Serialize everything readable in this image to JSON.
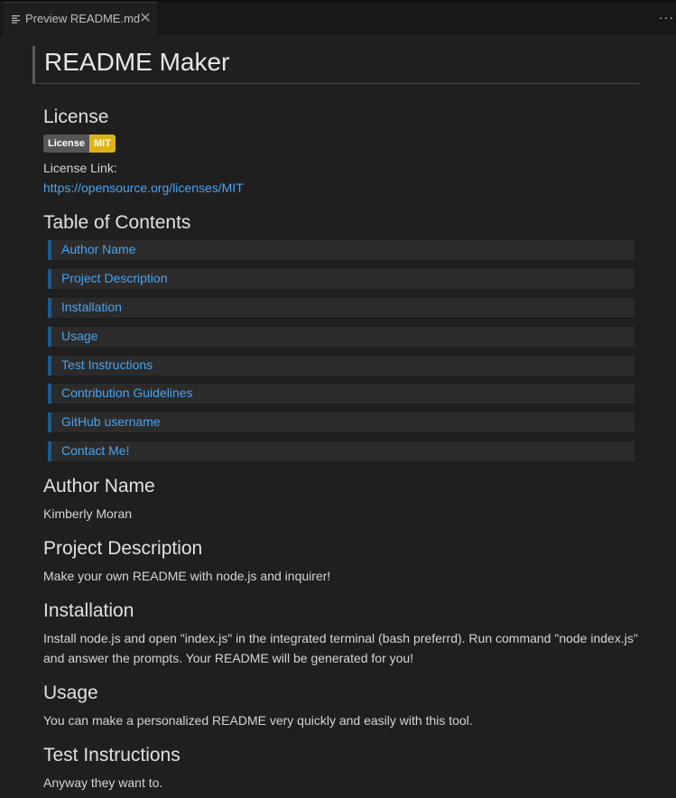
{
  "tab": {
    "title": "Preview README.md",
    "close_glyph": "✕",
    "icon": "preview-lines-icon"
  },
  "toolbar": {
    "more_glyph": "···"
  },
  "doc": {
    "title": "README Maker",
    "license": {
      "heading": "License",
      "badge_label": "License",
      "badge_value": "MIT",
      "badge_color": "#dfb317",
      "link_label": "License Link:",
      "link_url": "https://opensource.org/licenses/MIT"
    },
    "toc": {
      "heading": "Table of Contents",
      "items": [
        "Author Name",
        "Project Description",
        "Installation",
        "Usage",
        "Test Instructions",
        "Contribution Guidelines",
        "GitHub username",
        "Contact Me!"
      ]
    },
    "author": {
      "heading": "Author Name",
      "text": "Kimberly Moran"
    },
    "description": {
      "heading": "Project Description",
      "text": "Make your own README with node.js and inquirer!"
    },
    "installation": {
      "heading": "Installation",
      "line1": "Install node.js and open \"index.js\" in the integrated terminal (bash preferrd). Run command \"node index.js\"",
      "line2": "and answer the prompts. Your README will be generated for you!"
    },
    "usage": {
      "heading": "Usage",
      "text": "You can make a personalized README very quickly and easily with this tool."
    },
    "tests": {
      "heading": "Test Instructions",
      "text": "Anyway they want to."
    }
  },
  "colors": {
    "background": "#1f1f1f",
    "link": "#4aa3f0",
    "toc_bar": "#1d5a8c"
  }
}
